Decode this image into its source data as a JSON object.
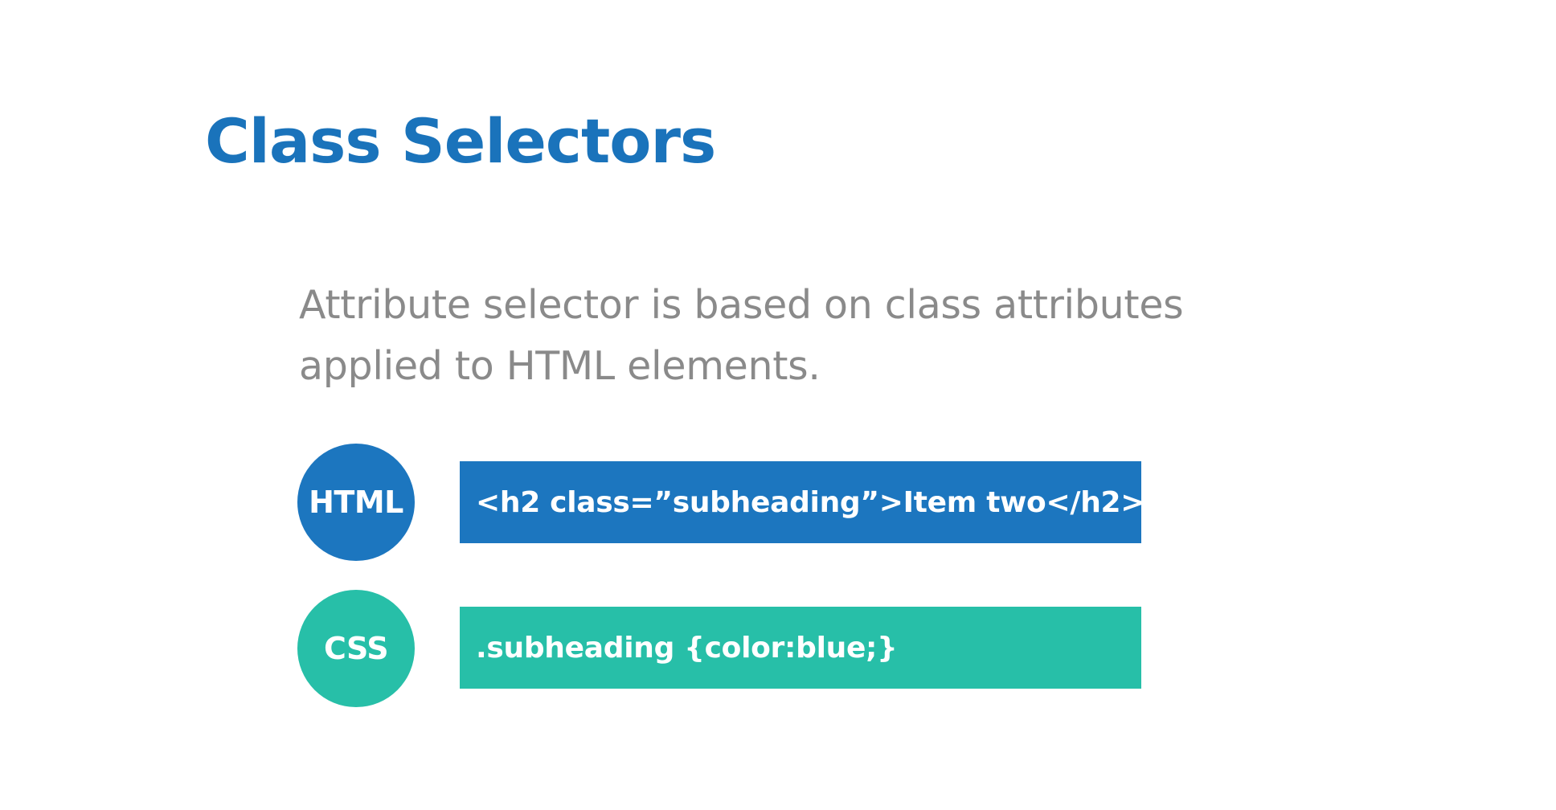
{
  "slide": {
    "title": "Class Selectors",
    "body_lines": [
      "Attribute selector is based on class attributes",
      "applied to HTML elements."
    ],
    "examples": [
      {
        "badge": "HTML",
        "code": "<h2 class=”subheading”>Item two</h2>",
        "color": "#1c76bf"
      },
      {
        "badge": "CSS",
        "code": ".subheading {color:blue;}",
        "color": "#27bfa8"
      }
    ]
  },
  "colors": {
    "title": "#1a73bb",
    "body_text": "#8a8a8a",
    "background": "#ffffff"
  }
}
